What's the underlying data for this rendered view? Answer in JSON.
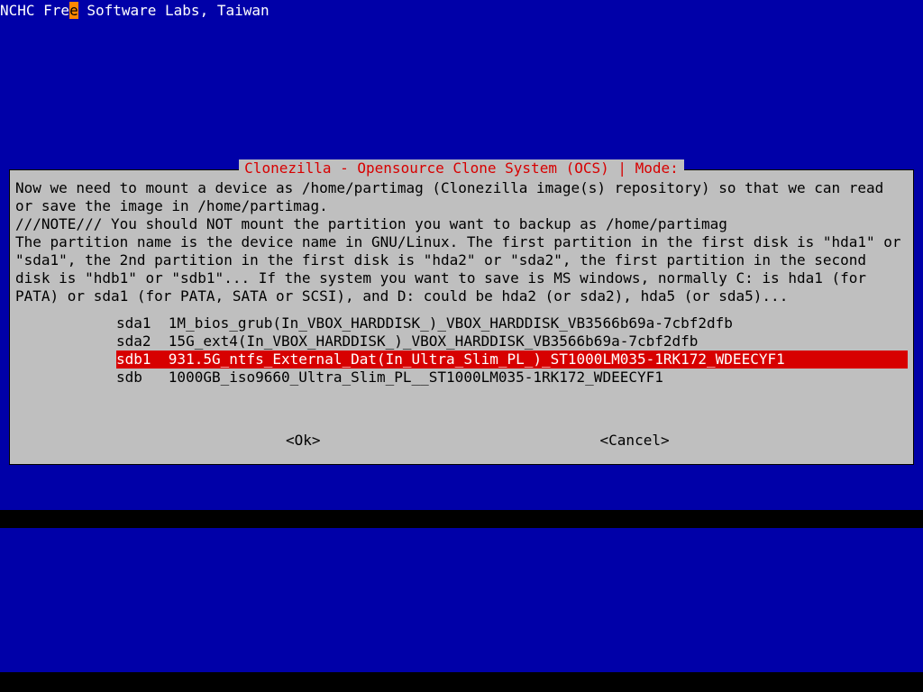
{
  "header": {
    "pre_cursor": "NCHC Fre",
    "cursor_char": "e",
    "post_cursor": " Software Labs, Taiwan"
  },
  "dialog": {
    "title": "Clonezilla - Opensource Clone System (OCS) | Mode:",
    "body_lines": [
      "Now we need to mount a device as /home/partimag (Clonezilla image(s) repository) so that we can read or save the image in /home/partimag.",
      "///NOTE/// You should NOT mount the partition you want to backup as /home/partimag",
      "The partition name is the device name in GNU/Linux. The first partition in the first disk is \"hda1\" or \"sda1\", the 2nd partition in the first disk is \"hda2\" or \"sda2\", the first partition in the second disk is \"hdb1\" or \"sdb1\"... If the system you want to save is MS windows, normally C: is hda1 (for PATA) or sda1 (for PATA, SATA or SCSI), and D: could be hda2 (or sda2), hda5 (or sda5)..."
    ],
    "options": [
      {
        "dev": "sda1",
        "desc": "1M_bios_grub(In_VBOX_HARDDISK_)_VBOX_HARDDISK_VB3566b69a-7cbf2dfb",
        "selected": false
      },
      {
        "dev": "sda2",
        "desc": "15G_ext4(In_VBOX_HARDDISK_)_VBOX_HARDDISK_VB3566b69a-7cbf2dfb",
        "selected": false
      },
      {
        "dev": "sdb1",
        "desc": "931.5G_ntfs_External_Dat(In_Ultra_Slim_PL_)_ST1000LM035-1RK172_WDEECYF1",
        "selected": true
      },
      {
        "dev": "sdb",
        "desc": "1000GB_iso9660_Ultra_Slim_PL__ST1000LM035-1RK172_WDEECYF1",
        "selected": false
      }
    ],
    "buttons": {
      "ok": "<Ok>",
      "cancel": "<Cancel>"
    }
  }
}
